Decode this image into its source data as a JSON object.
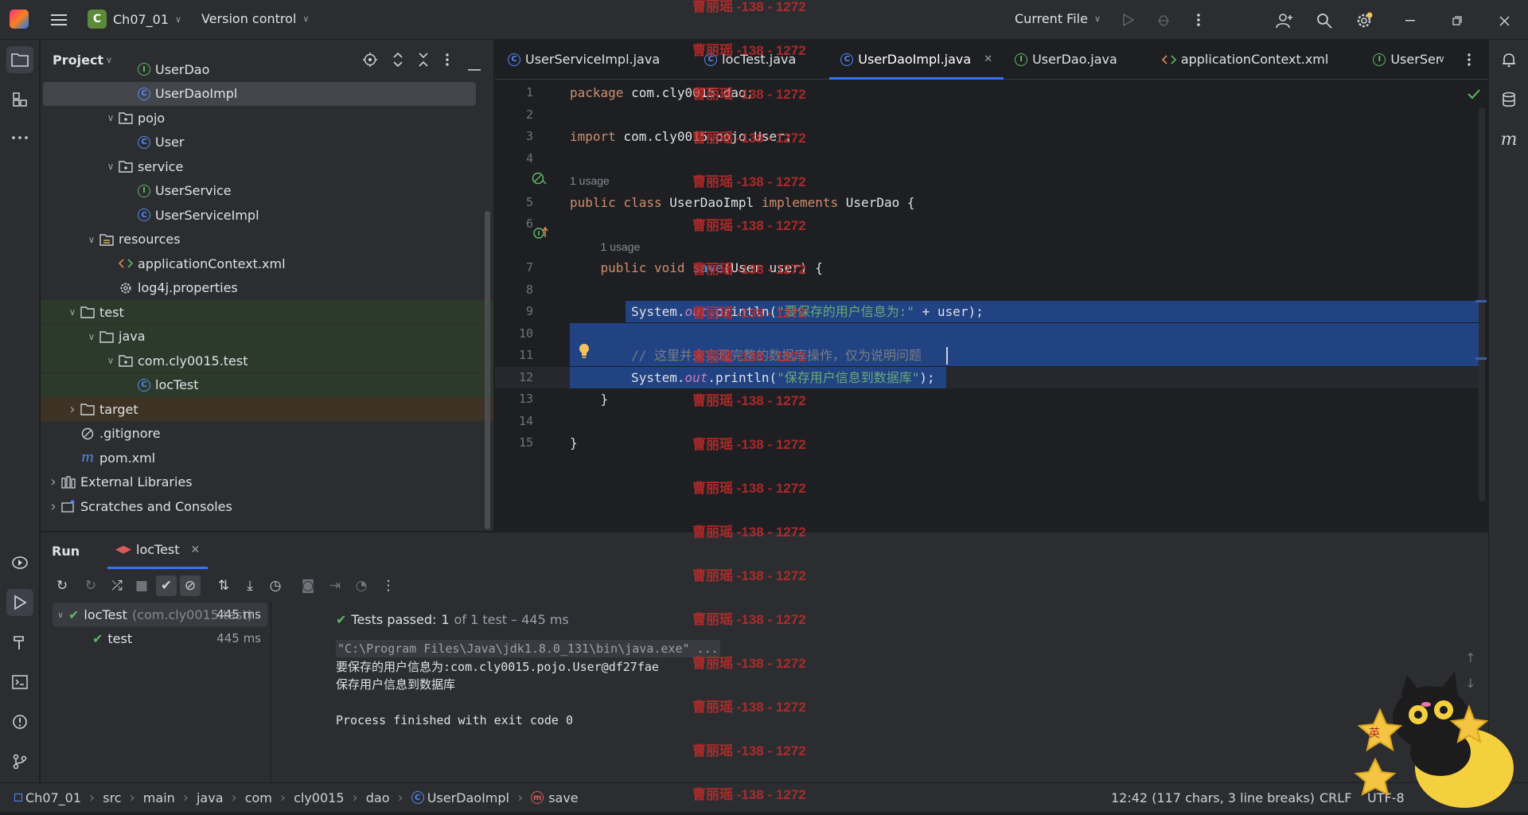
{
  "titlebar": {
    "project_letter": "C",
    "project_name": "Ch07_01",
    "vcs_label": "Version control",
    "run_config": "Current File"
  },
  "project_panel": {
    "title": "Project",
    "rows": [
      {
        "label": "UserDao",
        "kind": "interface",
        "indent": 4,
        "chev": ""
      },
      {
        "label": "UserDaoImpl",
        "kind": "class",
        "indent": 4,
        "chev": "",
        "selected": true
      },
      {
        "label": "pojo",
        "kind": "package",
        "indent": 3,
        "chev": "v"
      },
      {
        "label": "User",
        "kind": "class",
        "indent": 4,
        "chev": ""
      },
      {
        "label": "service",
        "kind": "package",
        "indent": 3,
        "chev": "v"
      },
      {
        "label": "UserService",
        "kind": "interface",
        "indent": 4,
        "chev": ""
      },
      {
        "label": "UserServiceImpl",
        "kind": "class",
        "indent": 4,
        "chev": ""
      },
      {
        "label": "resources",
        "kind": "resfolder",
        "indent": 2,
        "chev": "v"
      },
      {
        "label": "applicationContext.xml",
        "kind": "xml",
        "indent": 3,
        "chev": ""
      },
      {
        "label": "log4j.properties",
        "kind": "props",
        "indent": 3,
        "chev": ""
      },
      {
        "label": "test",
        "kind": "folder",
        "indent": 1,
        "chev": "v",
        "bg": "green"
      },
      {
        "label": "java",
        "kind": "folder",
        "indent": 2,
        "chev": "v",
        "bg": "green"
      },
      {
        "label": "com.cly0015.test",
        "kind": "package",
        "indent": 3,
        "chev": "v",
        "bg": "green"
      },
      {
        "label": "locTest",
        "kind": "class",
        "indent": 4,
        "chev": "",
        "bg": "green"
      },
      {
        "label": "target",
        "kind": "folder",
        "indent": 1,
        "chev": ">",
        "bg": "orange"
      },
      {
        "label": ".gitignore",
        "kind": "ignore",
        "indent": 1,
        "chev": ""
      },
      {
        "label": "pom.xml",
        "kind": "maven",
        "indent": 1,
        "chev": ""
      },
      {
        "label": "External Libraries",
        "kind": "lib",
        "indent": 0,
        "chev": ">"
      },
      {
        "label": "Scratches and Consoles",
        "kind": "scratch",
        "indent": 0,
        "chev": ">"
      }
    ]
  },
  "editor": {
    "tabs": [
      {
        "label": "UserServiceImpl.java",
        "kind": "class"
      },
      {
        "label": "locTest.java",
        "kind": "class"
      },
      {
        "label": "UserDaoImpl.java",
        "kind": "class",
        "active": true
      },
      {
        "label": "UserDao.java",
        "kind": "interface"
      },
      {
        "label": "applicationContext.xml",
        "kind": "xml"
      },
      {
        "label": "UserSer",
        "kind": "interface"
      }
    ],
    "lines": [
      {
        "n": "1",
        "html": "<span class='kw'>package</span> com.cly0015.dao;"
      },
      {
        "n": "2",
        "html": ""
      },
      {
        "n": "3",
        "html": "<span class='kw'>import</span> com.cly0015.pojo.User;"
      },
      {
        "n": "4",
        "html": ""
      },
      {
        "n": "",
        "html": "<span class='hint'>1 usage</span>"
      },
      {
        "n": "5",
        "html": "<span class='kw'>public class</span> UserDaoImpl <span class='kw'>implements</span> UserDao {"
      },
      {
        "n": "6",
        "html": ""
      },
      {
        "n": "",
        "html": "    <span class='hint'>1 usage</span>"
      },
      {
        "n": "7",
        "html": "    <span class='kw'>public void</span> <span style='color:#56a8f5'>save</span>(User user) {"
      },
      {
        "n": "8",
        "html": ""
      },
      {
        "n": "9",
        "html": "        System.<span class='it'>out</span>.println(<span class='str'>\"要保存的用户信息为:\"</span> + user);",
        "sel": true
      },
      {
        "n": "10",
        "html": "",
        "sel": true
      },
      {
        "n": "11",
        "html": "        <span class='cm'>// 这里并未实现完整的数据库操作，仅为说明问题</span>",
        "sel": true
      },
      {
        "n": "12",
        "html": "        System.<span class='it'>out</span>.println(<span class='str'>\"保存用户信息到数据库\"</span>);",
        "sel": "partial",
        "current": true
      },
      {
        "n": "13",
        "html": "    }"
      },
      {
        "n": "14",
        "html": ""
      },
      {
        "n": "15",
        "html": "}"
      }
    ]
  },
  "run": {
    "tab_run": "Run",
    "tab_config": "locTest",
    "tree": [
      {
        "label": "locTest",
        "sub": "(com.cly0015.test)",
        "time": "445 ms"
      },
      {
        "label": "test",
        "sub": "",
        "time": "445 ms"
      }
    ],
    "summary_pass": "Tests passed:",
    "summary_count": "1",
    "summary_rest": "of 1 test – 445 ms",
    "console": [
      "\"C:\\Program Files\\Java\\jdk1.8.0_131\\bin\\java.exe\" ...",
      "要保存的用户信息为:com.cly0015.pojo.User@df27fae",
      "保存用户信息到数据库",
      "",
      "Process finished with exit code 0"
    ]
  },
  "statusbar": {
    "crumbs": [
      "Ch07_01",
      "src",
      "main",
      "java",
      "com",
      "cly0015",
      "dao",
      "UserDaoImpl",
      "save"
    ],
    "position": "12:42 (117 chars, 3 line breaks)",
    "line_sep": "CRLF",
    "encoding": "UTF-8"
  },
  "watermark": "曹丽瑶 -138 - 1272",
  "sticker_text": "英"
}
